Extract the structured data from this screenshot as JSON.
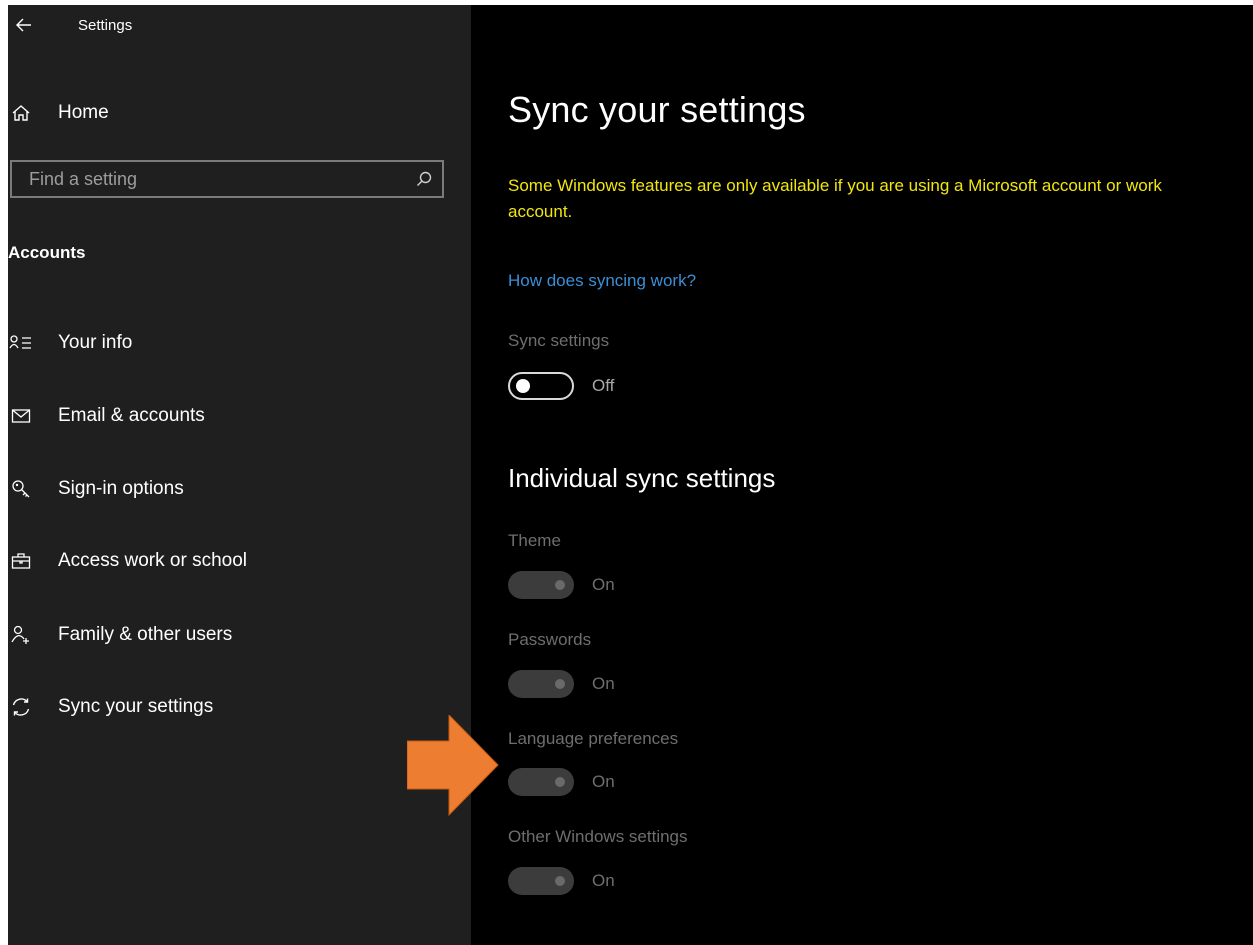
{
  "window": {
    "title": "Settings"
  },
  "sidebar": {
    "home_label": "Home",
    "search": {
      "placeholder": "Find a setting",
      "value": ""
    },
    "section_heading": "Accounts",
    "items": [
      {
        "label": "Your info",
        "icon": "person-list-icon"
      },
      {
        "label": "Email & accounts",
        "icon": "mail-icon"
      },
      {
        "label": "Sign-in options",
        "icon": "key-icon"
      },
      {
        "label": "Access work or school",
        "icon": "briefcase-icon"
      },
      {
        "label": "Family & other users",
        "icon": "add-person-icon"
      },
      {
        "label": "Sync your settings",
        "icon": "sync-icon"
      }
    ]
  },
  "main": {
    "title": "Sync your settings",
    "notice": "Some Windows features are only available if you are using a Microsoft account or work account.",
    "help_link": "How does syncing work?",
    "sync_settings": {
      "label": "Sync settings",
      "state": "Off",
      "on": false
    },
    "individual_title": "Individual sync settings",
    "individual": [
      {
        "label": "Theme",
        "state": "On",
        "on": true,
        "disabled": true
      },
      {
        "label": "Passwords",
        "state": "On",
        "on": true,
        "disabled": true
      },
      {
        "label": "Language preferences",
        "state": "On",
        "on": true,
        "disabled": true
      },
      {
        "label": "Other Windows settings",
        "state": "On",
        "on": true,
        "disabled": true
      }
    ]
  },
  "colors": {
    "sidebar_bg": "#1f1f1f",
    "main_bg": "#000000",
    "notice": "#f2e60c",
    "link": "#3a8fd6",
    "disabled_text": "#6e6e6e",
    "annotation_arrow": "#ed7d31"
  }
}
